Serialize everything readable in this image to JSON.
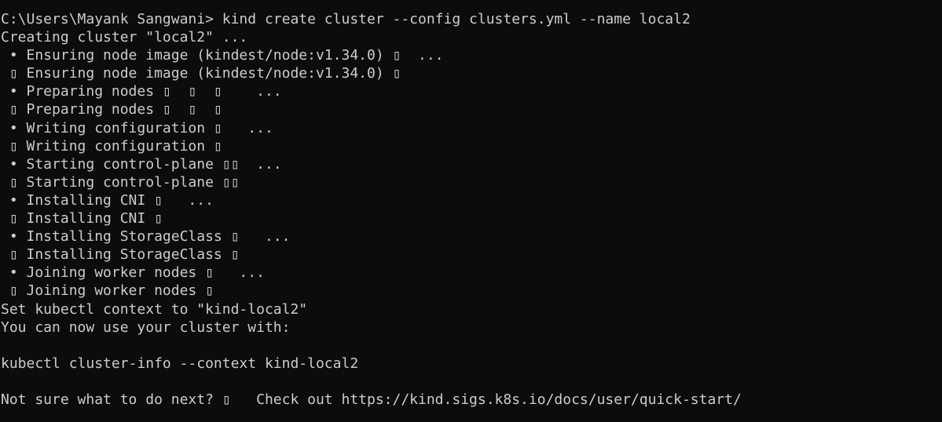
{
  "terminal": {
    "lines": [
      "C:\\Users\\Mayank Sangwani> kind create cluster --config clusters.yml --name local2",
      "Creating cluster \"local2\" ...",
      " • Ensuring node image (kindest/node:v1.34.0) ▯  ...",
      " ▯ Ensuring node image (kindest/node:v1.34.0) ▯",
      " • Preparing nodes ▯  ▯  ▯    ...",
      " ▯ Preparing nodes ▯  ▯  ▯",
      " • Writing configuration ▯   ...",
      " ▯ Writing configuration ▯",
      " • Starting control-plane ▯▯  ...",
      " ▯ Starting control-plane ▯▯",
      " • Installing CNI ▯   ...",
      " ▯ Installing CNI ▯",
      " • Installing StorageClass ▯   ...",
      " ▯ Installing StorageClass ▯",
      " • Joining worker nodes ▯   ...",
      " ▯ Joining worker nodes ▯",
      "Set kubectl context to \"kind-local2\"",
      "You can now use your cluster with:",
      "",
      "kubectl cluster-info --context kind-local2",
      "",
      "Not sure what to do next? ▯   Check out https://kind.sigs.k8s.io/docs/user/quick-start/"
    ]
  },
  "colors": {
    "background": "#0c0c0c",
    "foreground": "#cccccc"
  }
}
